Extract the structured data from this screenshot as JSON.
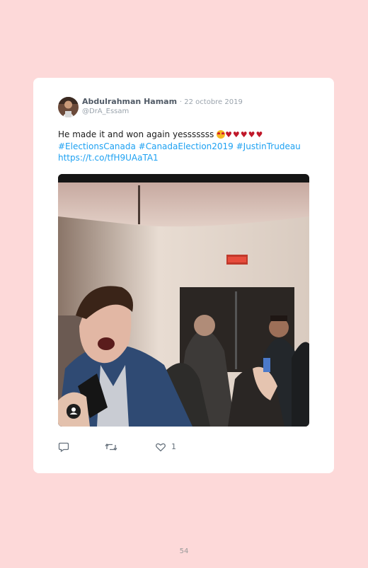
{
  "tweet": {
    "author_name": "Abdulrahman Hamam",
    "date": "· 22 octobre 2019",
    "handle": "@DrA_Essam",
    "text": "He made it and won again yesssssss",
    "hearts": "♥♥♥♥♥",
    "hashtags": "#ElectionsCanada #CanadaElection2019 #JustinTrudeau",
    "url": "https://t.co/tfH9UAaTA1"
  },
  "actions": {
    "like_count": "1"
  },
  "icons": {
    "reply": "comment-icon",
    "retweet": "retweet-icon",
    "like": "heart-icon",
    "media_badge": "user-icon"
  },
  "colors": {
    "background": "#fdd9d9",
    "card": "#ffffff",
    "link": "#1da1f2",
    "heart": "#c0182a"
  },
  "page": {
    "number": "54"
  }
}
